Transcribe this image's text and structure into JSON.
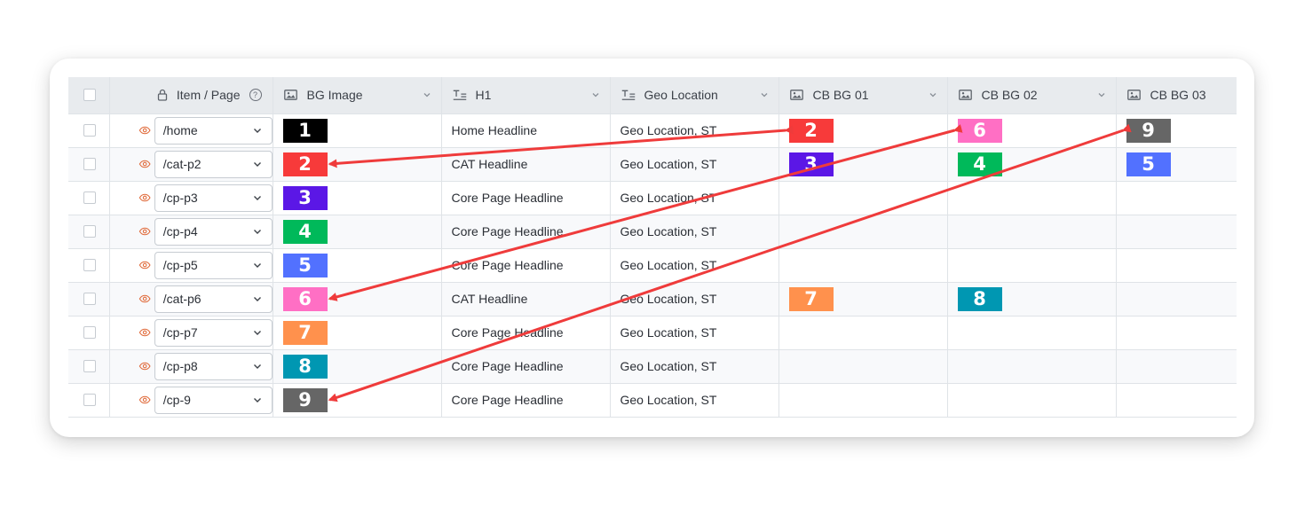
{
  "table": {
    "headers": {
      "page": "Item / Page",
      "help": "?",
      "bg_image": "BG Image",
      "h1": "H1",
      "geo": "Geo Location",
      "cb1": "CB BG 01",
      "cb2": "CB BG 02",
      "cb3": "CB BG 03"
    },
    "rows": [
      {
        "page": "/home",
        "bg": "1",
        "bg_color": "#000000",
        "h1": "Home Headline",
        "geo": "Geo Location, ST",
        "cb1": "2",
        "cb1_color": "#f73a3a",
        "cb2": "6",
        "cb2_color": "#ff6fc4",
        "cb3": "9",
        "cb3_color": "#666666"
      },
      {
        "page": "/cat-p2",
        "bg": "2",
        "bg_color": "#f73a3a",
        "h1": "CAT Headline",
        "geo": "Geo Location, ST",
        "cb1": "3",
        "cb1_color": "#5b17e6",
        "cb2": "4",
        "cb2_color": "#00b95a",
        "cb3": "5",
        "cb3_color": "#5271ff"
      },
      {
        "page": "/cp-p3",
        "bg": "3",
        "bg_color": "#5b17e6",
        "h1": "Core Page Headline",
        "geo": "Geo Location, ST"
      },
      {
        "page": "/cp-p4",
        "bg": "4",
        "bg_color": "#00b95a",
        "h1": "Core Page Headline",
        "geo": "Geo Location, ST"
      },
      {
        "page": "/cp-p5",
        "bg": "5",
        "bg_color": "#5271ff",
        "h1": "Core Page Headline",
        "geo": "Geo Location, ST"
      },
      {
        "page": "/cat-p6",
        "bg": "6",
        "bg_color": "#ff6fc4",
        "h1": "CAT Headline",
        "geo": "Geo Location, ST",
        "cb1": "7",
        "cb1_color": "#ff914d",
        "cb2": "8",
        "cb2_color": "#0097b2"
      },
      {
        "page": "/cp-p7",
        "bg": "7",
        "bg_color": "#ff914d",
        "h1": "Core Page Headline",
        "geo": "Geo Location, ST"
      },
      {
        "page": "/cp-p8",
        "bg": "8",
        "bg_color": "#0097b2",
        "h1": "Core Page Headline",
        "geo": "Geo Location, ST"
      },
      {
        "page": "/cp-9",
        "bg": "9",
        "bg_color": "#666666",
        "h1": "Core Page Headline",
        "geo": "Geo Location, ST"
      }
    ]
  },
  "icons": {
    "lock": "lock-icon",
    "help": "help-circle-icon",
    "image": "image-icon",
    "text": "text-icon",
    "chevron": "chevron-down-icon",
    "eye": "eye-icon"
  },
  "colors": {
    "arrow": "#ef3b3b",
    "eye": "#e06a3a",
    "header_bg": "#e8ebee"
  },
  "annotations": {
    "arrows": [
      {
        "from": "cb1-row-1",
        "to": "bg-row-2"
      },
      {
        "from": "cb2-row-1",
        "to": "bg-row-6"
      },
      {
        "from": "cb3-row-1",
        "to": "bg-row-9"
      }
    ]
  }
}
